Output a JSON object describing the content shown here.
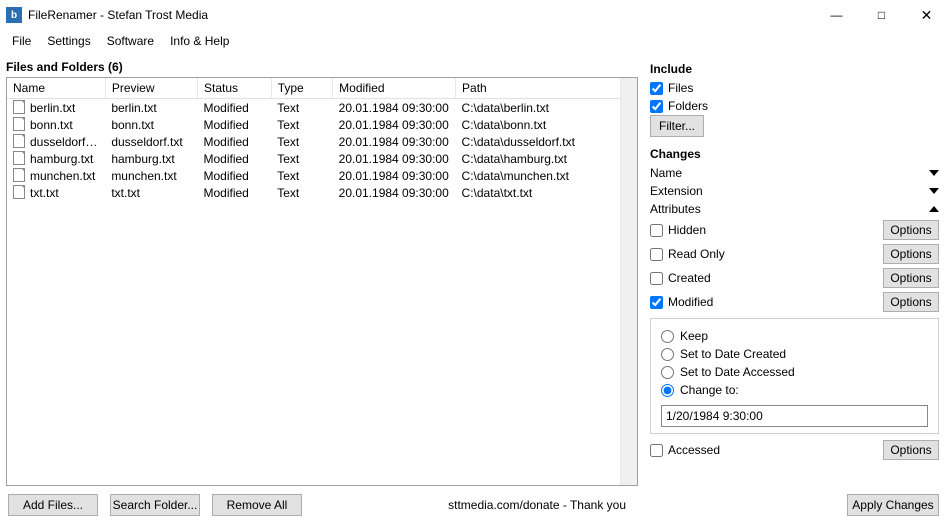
{
  "window": {
    "title": "FileRenamer - Stefan Trost Media"
  },
  "menu": {
    "file": "File",
    "settings": "Settings",
    "software": "Software",
    "info": "Info & Help"
  },
  "filesFolders": {
    "heading": "Files and Folders (6)",
    "cols": {
      "name": "Name",
      "preview": "Preview",
      "status": "Status",
      "type": "Type",
      "modified": "Modified",
      "path": "Path"
    },
    "rows": [
      {
        "name": "berlin.txt",
        "preview": "berlin.txt",
        "status": "Modified",
        "type": "Text",
        "modified": "20.01.1984 09:30:00",
        "path": "C:\\data\\berlin.txt"
      },
      {
        "name": "bonn.txt",
        "preview": "bonn.txt",
        "status": "Modified",
        "type": "Text",
        "modified": "20.01.1984 09:30:00",
        "path": "C:\\data\\bonn.txt"
      },
      {
        "name": "dusseldorf.txt",
        "preview": "dusseldorf.txt",
        "status": "Modified",
        "type": "Text",
        "modified": "20.01.1984 09:30:00",
        "path": "C:\\data\\dusseldorf.txt"
      },
      {
        "name": "hamburg.txt",
        "preview": "hamburg.txt",
        "status": "Modified",
        "type": "Text",
        "modified": "20.01.1984 09:30:00",
        "path": "C:\\data\\hamburg.txt"
      },
      {
        "name": "munchen.txt",
        "preview": "munchen.txt",
        "status": "Modified",
        "type": "Text",
        "modified": "20.01.1984 09:30:00",
        "path": "C:\\data\\munchen.txt"
      },
      {
        "name": "txt.txt",
        "preview": "txt.txt",
        "status": "Modified",
        "type": "Text",
        "modified": "20.01.1984 09:30:00",
        "path": "C:\\data\\txt.txt"
      }
    ]
  },
  "bottom": {
    "addFiles": "Add Files...",
    "searchFolder": "Search Folder...",
    "removeAll": "Remove All",
    "footer": "sttmedia.com/donate - Thank you",
    "apply": "Apply Changes"
  },
  "include": {
    "heading": "Include",
    "files": "Files",
    "folders": "Folders",
    "filter": "Filter..."
  },
  "changes": {
    "heading": "Changes",
    "name": "Name",
    "extension": "Extension",
    "attributes": "Attributes",
    "hidden": "Hidden",
    "readonly": "Read Only",
    "created": "Created",
    "modified": "Modified",
    "accessed": "Accessed",
    "options": "Options",
    "keep": "Keep",
    "setCreated": "Set to Date Created",
    "setAccessed": "Set to Date Accessed",
    "changeTo": "Change to:",
    "changeToValue": "1/20/1984 9:30:00"
  }
}
